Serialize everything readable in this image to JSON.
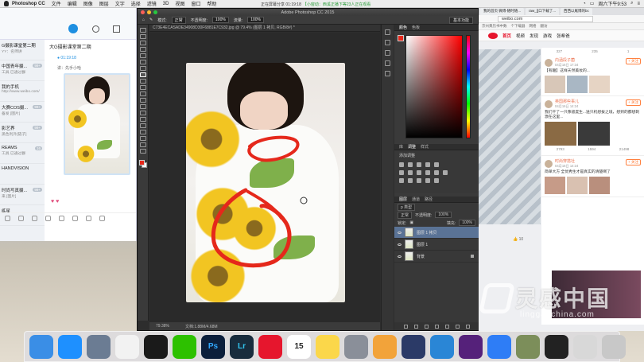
{
  "menubar": {
    "app": "Photoshop CC",
    "items": [
      "文件",
      "编辑",
      "图像",
      "图层",
      "文字",
      "选择",
      "滤镜",
      "3D",
      "视图",
      "窗口",
      "帮助"
    ],
    "share_status": "正在屏幕分享 01:19:18",
    "share_link": "【小窗动：西溪正播下等23人正在观看",
    "clock": "周六下午9:53"
  },
  "qq": {
    "chat_title": "大G摄影课堂第二期",
    "live_time": "01:19:18",
    "message_preview": "讲：先手小哈",
    "contacts": [
      {
        "name": "G摄影课堂第二期",
        "sub": "YY：名师讲",
        "badge": ""
      },
      {
        "name": "中国青年摄...",
        "sub": "工具 已通过群",
        "badge": "99+"
      },
      {
        "name": "我的手机",
        "sub": "http://www.weibo.com/",
        "badge": ""
      },
      {
        "name": "大赛COS摄...",
        "sub": "备发 [图片]",
        "badge": "99+"
      },
      {
        "name": "影艺界",
        "sub": "黑色利外[链子]",
        "badge": "99+"
      },
      {
        "name": "REAMS",
        "sub": "工具 已通过群",
        "badge": "16"
      },
      {
        "name": "HANDVISION",
        "sub": "",
        "badge": ""
      },
      {
        "name": "时尚写真摄...",
        "sub": "来 [图片]",
        "badge": "99+"
      },
      {
        "name": "练星",
        "sub": "",
        "badge": ""
      }
    ]
  },
  "photoshop": {
    "window_title": "Adobe Photoshop CC 2015",
    "options": {
      "mode_label": "模式:",
      "mode": "正常",
      "opacity_label": "不透明度:",
      "opacity": "100%",
      "flow_label": "流量:",
      "flow": "100%",
      "workspace": "基本功能"
    },
    "doc_tab": "C73E4ECASADE34908D30F6881E7C932.jpg @ 79.4% (图层 1 拷贝, RGB/8#) *",
    "status": {
      "zoom": "79.38%",
      "doc": "文档:1.88M/4.68M"
    },
    "color_tabs": [
      "颜色",
      "色板"
    ],
    "adjust_tabs": [
      "库",
      "调整",
      "样式"
    ],
    "adjust_label": "添加调整",
    "layer_tabs": [
      "图层",
      "通道",
      "路径"
    ],
    "layer_kind": "p 类型",
    "blend_mode": "正常",
    "opacity_label": "不透明度:",
    "opacity": "100%",
    "lock_label": "锁定:",
    "fill_label": "填充:",
    "fill": "100%",
    "layers": [
      {
        "name": "图层 1 拷贝",
        "selected": true
      },
      {
        "name": "图层 1",
        "selected": false
      },
      {
        "name": "背景",
        "selected": false
      }
    ]
  },
  "browser": {
    "tabs": [
      "weibo.com",
      "我的首页 微博-随时随...",
      "raw_[]口下载了...",
      "西西以尾博的bc"
    ],
    "url": "weibo.com",
    "bookmarks": [
      "京州黄历书中数",
      "个下载器",
      "网络",
      "翻访"
    ],
    "nav": [
      "首页",
      "视频",
      "发现",
      "游戏",
      "张希爸"
    ],
    "stats": [
      "327",
      "235",
      "1"
    ],
    "posts": [
      {
        "name": "内涵段子菌",
        "time": "04月16日 17:34",
        "text": "【有趣】这样天然美妆的...",
        "follow": "+ 关注"
      },
      {
        "name": "英国那些事儿",
        "time": "04月16日 14:24",
        "text": "我们干了一只像极度生...送只机想拔之境，想到的都想刺激在这里...",
        "follow": "+ 关注"
      },
      {
        "name": "时尚穿搭社",
        "time": "04月16日 14:24",
        "text": "简单大方 全优秀生才是真实的清楚啊了",
        "follow": "+ 关注"
      }
    ],
    "likes": [
      "2793",
      "1594",
      "21498"
    ],
    "comment_count": "10"
  },
  "watermark": {
    "brand": "灵感中国",
    "url": "lingganchina.com"
  },
  "dock": {
    "apps": [
      {
        "name": "finder",
        "color": "#3a8ee6",
        "glyph": ""
      },
      {
        "name": "safari",
        "color": "#1e90ff",
        "glyph": ""
      },
      {
        "name": "launchpad",
        "color": "#6b7c93",
        "glyph": ""
      },
      {
        "name": "reminders",
        "color": "#f2f2f2",
        "glyph": ""
      },
      {
        "name": "qq",
        "color": "#1a1a1a",
        "glyph": ""
      },
      {
        "name": "wechat",
        "color": "#2dc100",
        "glyph": ""
      },
      {
        "name": "photoshop",
        "color": "#0c1f3b",
        "glyph": "Ps"
      },
      {
        "name": "lightroom",
        "color": "#182c3d",
        "glyph": "Lr"
      },
      {
        "name": "weibo",
        "color": "#e6162d",
        "glyph": ""
      },
      {
        "name": "calendar",
        "color": "#ffffff",
        "glyph": "15"
      },
      {
        "name": "notes",
        "color": "#fbd74a",
        "glyph": ""
      },
      {
        "name": "system-preferences",
        "color": "#8a8f99",
        "glyph": ""
      },
      {
        "name": "photos",
        "color": "#f2a33a",
        "glyph": ""
      },
      {
        "name": "video",
        "color": "#2b3a67",
        "glyph": ""
      },
      {
        "name": "bird",
        "color": "#2a86d6",
        "glyph": ""
      },
      {
        "name": "player",
        "color": "#55217a",
        "glyph": ""
      },
      {
        "name": "baidu-cloud",
        "color": "#2e7df6",
        "glyph": ""
      },
      {
        "name": "folder-images",
        "color": "#7c8e5a",
        "glyph": ""
      },
      {
        "name": "screen-dark",
        "color": "#222",
        "glyph": ""
      },
      {
        "name": "grid-app",
        "color": "#d8d8d8",
        "glyph": ""
      },
      {
        "name": "trash",
        "color": "#c8c8c8",
        "glyph": ""
      }
    ]
  },
  "colors": {
    "brush_red": "#e5281b",
    "ps_bg": "#2d2d2d",
    "selected_layer": "#5a7396",
    "weibo_orange": "#eb7350"
  }
}
